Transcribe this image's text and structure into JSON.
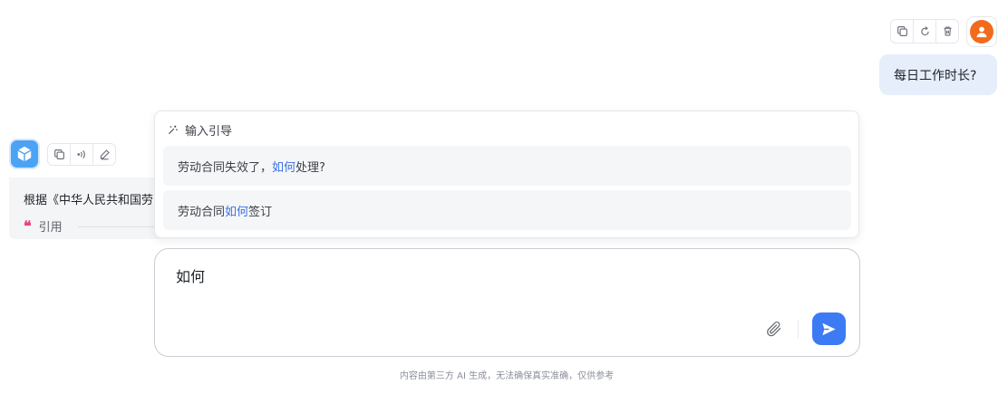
{
  "user_message": {
    "text": "每日工作时长?",
    "actions": [
      "copy-icon",
      "refresh-icon",
      "trash-icon"
    ],
    "avatar_color": "#f26a1b"
  },
  "assistant_message": {
    "text": "根据《中华人民共和国劳",
    "citation_label": "引用",
    "actions": [
      "copy-icon",
      "broadcast-icon",
      "edit-icon"
    ],
    "avatar_color": "#4ca3f3"
  },
  "suggestions": {
    "title": "输入引导",
    "items": [
      {
        "before": "劳动合同失效了，",
        "highlight": "如何",
        "after": "处理?"
      },
      {
        "before": "劳动合同",
        "highlight": "如何",
        "after": "签订"
      }
    ],
    "highlight_color": "#3770e6"
  },
  "input": {
    "value": "如何"
  },
  "footer": {
    "disclaimer": "内容由第三方 AI 生成，无法确保真实准确，仅供参考"
  },
  "colors": {
    "accent": "#3d7bf5",
    "user_bubble": "#e6edfb",
    "citation": "#e8457c"
  }
}
